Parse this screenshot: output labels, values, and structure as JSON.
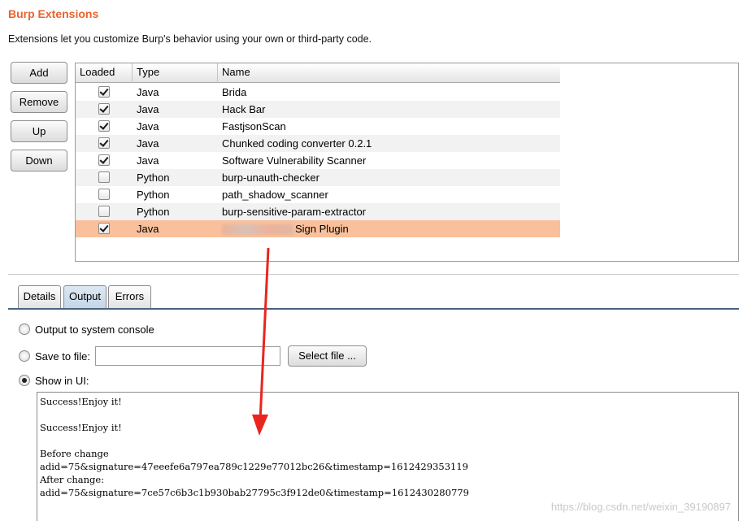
{
  "header": {
    "title": "Burp Extensions",
    "description": "Extensions let you customize Burp's behavior using your own or third-party code."
  },
  "buttons": {
    "add": "Add",
    "remove": "Remove",
    "up": "Up",
    "down": "Down"
  },
  "table": {
    "columns": [
      "Loaded",
      "Type",
      "Name"
    ],
    "rows": [
      {
        "loaded": true,
        "type": "Java",
        "name": "Brida"
      },
      {
        "loaded": true,
        "type": "Java",
        "name": "Hack Bar"
      },
      {
        "loaded": true,
        "type": "Java",
        "name": "FastjsonScan"
      },
      {
        "loaded": true,
        "type": "Java",
        "name": "Chunked coding converter 0.2.1"
      },
      {
        "loaded": true,
        "type": "Java",
        "name": "Software Vulnerability Scanner"
      },
      {
        "loaded": false,
        "type": "Python",
        "name": "burp-unauth-checker"
      },
      {
        "loaded": false,
        "type": "Python",
        "name": "path_shadow_scanner"
      },
      {
        "loaded": false,
        "type": "Python",
        "name": "burp-sensitive-param-extractor"
      },
      {
        "loaded": true,
        "type": "Java",
        "name": "Sign Plugin",
        "selected": true
      }
    ]
  },
  "tabs": [
    "Details",
    "Output",
    "Errors"
  ],
  "active_tab": "Output",
  "output_options": {
    "system_console": "Output to system console",
    "save_to_file": "Save to file:",
    "file_value": "",
    "select_file": "Select file ...",
    "show_in_ui": "Show in UI:",
    "selected": "show_in_ui"
  },
  "output_lines": [
    "Success!Enjoy it!",
    "",
    "Success!Enjoy it!",
    "",
    "Before change",
    "adid=75&signature=47eeefe6a797ea789c1229e77012bc26&timestamp=1612429353119",
    "After change:",
    "adid=75&signature=7ce57c6b3c1b930bab27795c3f912de0&timestamp=1612430280779"
  ],
  "watermark": "https://blog.csdn.net/weixin_39190897",
  "colors": {
    "title": "#e8632c",
    "selected_row": "#f9c09b",
    "arrow": "#e8261f"
  }
}
